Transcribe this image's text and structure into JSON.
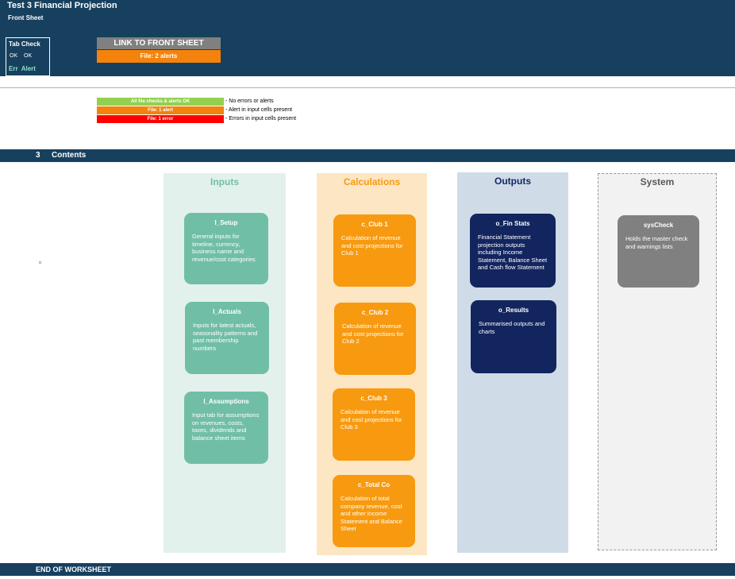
{
  "header": {
    "title": "Test 3 Financial Projection",
    "subtitle": "Front Sheet",
    "tab_check": {
      "title": "Tab Check",
      "ok1": "OK",
      "ok2": "OK",
      "err_alert": "Err  Alert"
    },
    "link_button": "LINK TO FRONT SHEET",
    "alert_status": "File: 2 alerts"
  },
  "legend": [
    {
      "bar": "All file checks & alerts OK",
      "text": "- No errors or alerts",
      "color": "#92d050"
    },
    {
      "bar": "File: 1 alert",
      "text": "- Alert in input cells present",
      "color": "#f5820a"
    },
    {
      "bar": "File: 1 error",
      "text": "- Errors in input cells present",
      "color": "#ff0000"
    }
  ],
  "contents": {
    "number": "3",
    "label": "Contents"
  },
  "columns": {
    "inputs": {
      "title": "Inputs",
      "color": "#71bea7",
      "cards": [
        {
          "title": "I_Setup",
          "desc": "General inputs for timeline, currency, business name and revenue/cost categories"
        },
        {
          "title": "I_Actuals",
          "desc": "Inputs for latest actuals, seasonality patterns and past membership numbers"
        },
        {
          "title": "I_Assumptions",
          "desc": "Input tab for assumptions on revenues, costs, taxes, dividends and balance sheet items"
        }
      ]
    },
    "calculations": {
      "title": "Calculations",
      "color": "#f79a10",
      "cards": [
        {
          "title": "c_Club 1",
          "desc": "Calculation of revenue and cost projections for Club 1"
        },
        {
          "title": "c_Club 2",
          "desc": "Calculation of revenue and cost projections for Club 2"
        },
        {
          "title": "c_Club 3",
          "desc": "Calculation of revenue and cost projections for Club 3"
        },
        {
          "title": "c_Total Co",
          "desc": "Calculation of total company revenue, cost and other Income Statement and Balance Sheet"
        }
      ]
    },
    "outputs": {
      "title": "Outputs",
      "color": "#13255f",
      "cards": [
        {
          "title": "o_Fin Stats",
          "desc": "Financial Statement projection outputs including Income Statement, Balance Sheet and Cash flow Statement"
        },
        {
          "title": "o_Results",
          "desc": "Summarised outputs and charts"
        }
      ]
    },
    "system": {
      "title": "System",
      "color": "#808080",
      "cards": [
        {
          "title": "sysCheck",
          "desc": "Holds the master check and warnings lists"
        }
      ]
    }
  },
  "footer": {
    "label": "END OF WORKSHEET"
  }
}
